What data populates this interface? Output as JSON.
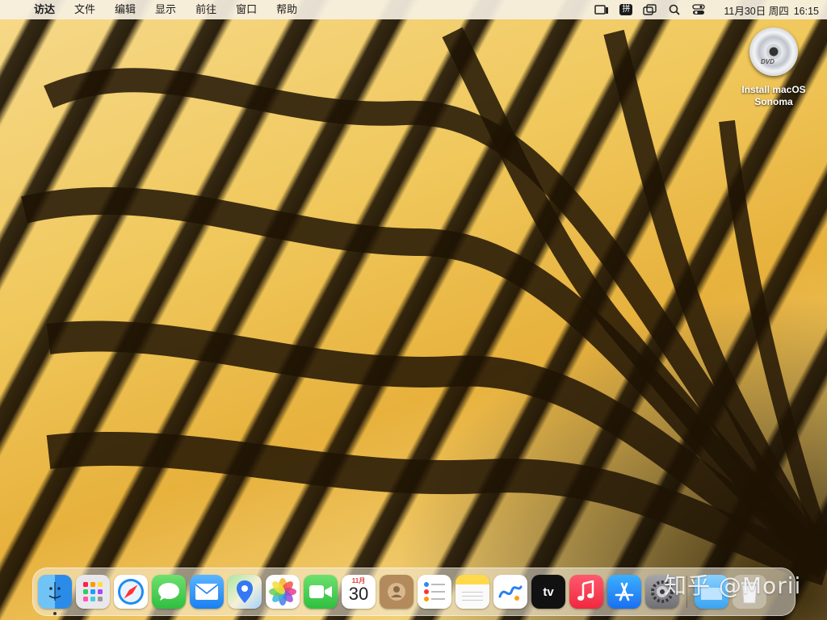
{
  "menubar": {
    "app_name": "访达",
    "items": [
      "文件",
      "编辑",
      "显示",
      "前往",
      "窗口",
      "帮助"
    ],
    "ime_label": "拼",
    "date": "11月30日 周四",
    "time": "16:15"
  },
  "desktop": {
    "icons": [
      {
        "label": "Install macOS Sonoma",
        "disc_text": "DVD"
      }
    ]
  },
  "dock": {
    "calendar_month": "11月",
    "calendar_day": "30",
    "tv_label": "tv"
  },
  "watermark": "知乎 @Morii"
}
